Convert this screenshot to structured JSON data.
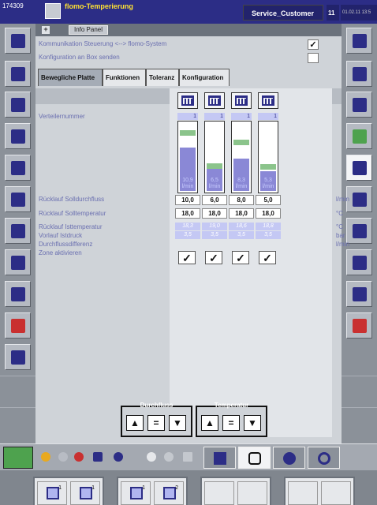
{
  "topbar": {
    "id": "174309",
    "title": "flomo-Temperierung",
    "user": "Service_Customer",
    "day": "11",
    "datetime": "01.02.11 13:5"
  },
  "info_panel": {
    "label": "Info Panel",
    "config_rows": [
      {
        "label": "Kommunikation Steuerung <--> flomo-System",
        "checked": "✓"
      },
      {
        "label": "Konfiguration an Box senden",
        "checked": ""
      }
    ]
  },
  "tabs": [
    {
      "label": "Bewegliche Platte",
      "active": true
    },
    {
      "label": "Funktionen",
      "active": false
    },
    {
      "label": "Toleranz",
      "active": false
    },
    {
      "label": "Konfiguration",
      "active": false
    }
  ],
  "rows": {
    "verteilernummer": "Verteilernummer",
    "ruecklauf_solldurchfluss": "Rücklauf Solldurchfluss",
    "ruecklauf_solltemperatur": "Rücklauf Solltemperatur",
    "ruecklauf_isttemperatur": "Rücklauf Isttemperatur",
    "vorlauf_istdruck": "Vorlauf Istdruck",
    "durchflussdifferenz": "Durchflussdifferenz",
    "zone_aktivieren": "Zone aktivieren"
  },
  "units": {
    "flow": "l/min",
    "temp_set": "°C",
    "temp_act": "°C",
    "pressure": "bar",
    "flow_diff": "l/min"
  },
  "zones": [
    {
      "verteiler": "1",
      "flow_display": "10,9\nl/min",
      "flow_set": "10,0",
      "temp_set": "18,0",
      "temp_act": "18,3",
      "pressure": "3,5",
      "active": "✓",
      "fill_fraction": 0.62,
      "band_fraction": 0.85
    },
    {
      "verteiler": "1",
      "flow_display": "6,5\nl/min",
      "flow_set": "6,0",
      "temp_set": "18,0",
      "temp_act": "19,0",
      "pressure": "3,5",
      "active": "✓",
      "fill_fraction": 0.38,
      "band_fraction": 0.38
    },
    {
      "verteiler": "1",
      "flow_display": "8,3\nl/min",
      "flow_set": "8,0",
      "temp_set": "18,0",
      "temp_act": "18,6",
      "pressure": "3,5",
      "active": "✓",
      "fill_fraction": 0.47,
      "band_fraction": 0.72
    },
    {
      "verteiler": "1",
      "flow_display": "5,3\nl/min",
      "flow_set": "5,0",
      "temp_set": "18,0",
      "temp_act": "18,8",
      "pressure": "3,5",
      "active": "✓",
      "fill_fraction": 0.28,
      "band_fraction": 0.36
    }
  ],
  "groups": {
    "durchfluss": "Durchfluss",
    "temperatur": "Temperatur",
    "up": "▲",
    "equal": "=",
    "down": "▼"
  },
  "bottom_keys": [
    {
      "n1": "1",
      "n2": "1"
    },
    {
      "n1": "1",
      "n2": "2"
    }
  ],
  "icons": {
    "left": [
      "grid-icon",
      "arrows-icon",
      "arrows-icon",
      "cross-icon",
      "tools-icon",
      "layers-icon",
      "ruler-icon",
      "pencil-icon",
      "screen-icon",
      "warning-icon",
      "chart-icon"
    ],
    "right": [
      "back-icon",
      "network-icon",
      "document-icon",
      "settings-icon",
      "printer-icon",
      "edit-icon",
      "checklist-icon",
      "note-icon",
      "info-icon",
      "alarm-icon"
    ]
  }
}
